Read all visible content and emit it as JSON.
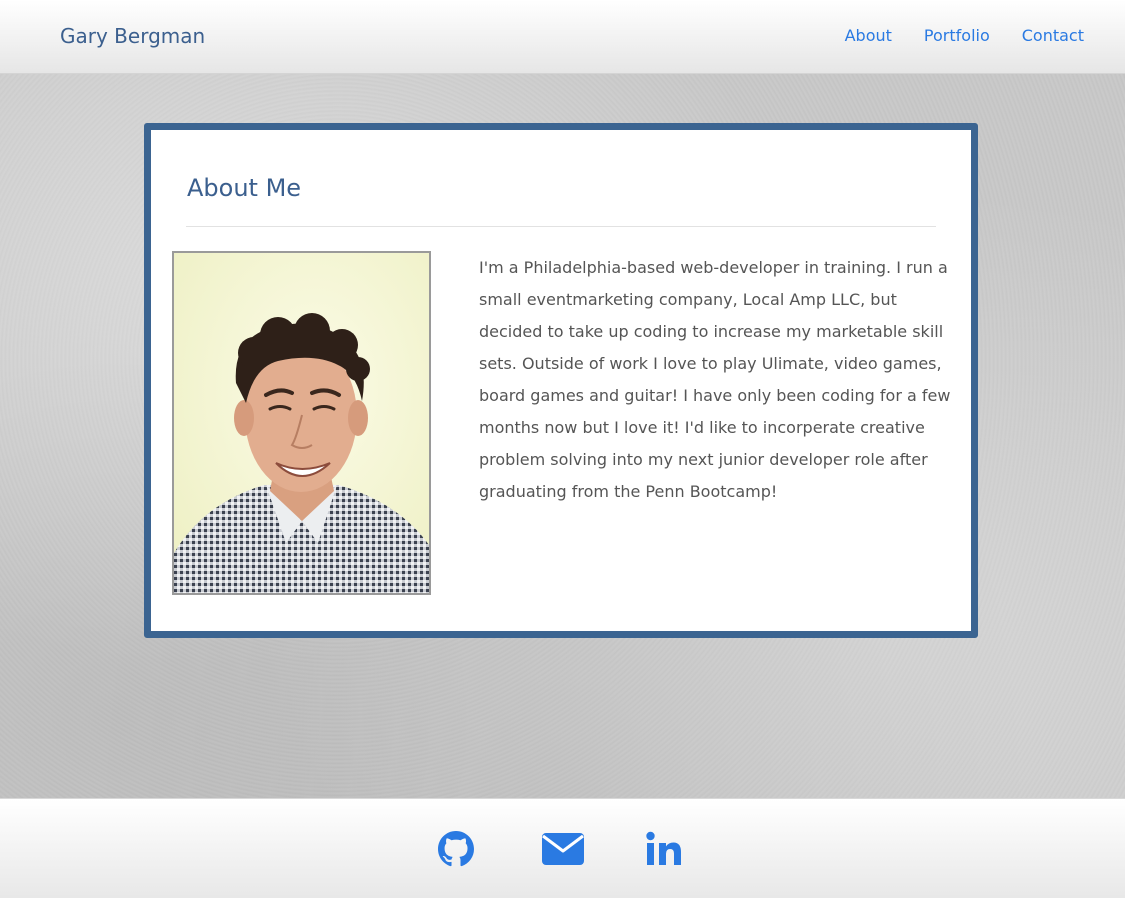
{
  "navbar": {
    "brand": "Gary Bergman",
    "links": [
      {
        "label": "About"
      },
      {
        "label": "Portfolio"
      },
      {
        "label": "Contact"
      }
    ]
  },
  "about": {
    "title": "About Me",
    "bio": "I'm a Philadelphia-based web-developer in training. I run a small eventmarketing company, Local Amp LLC, but decided to take up coding to increase my marketable skill sets. Outside of work I love to play Ulimate, video games, board games and guitar! I have only been coding for a few months now but I love it! I'd like to incorperate creative problem solving into my next junior developer role after graduating from the Penn Bootcamp!",
    "photo": {
      "subject": "portrait-photo"
    }
  },
  "footer": {
    "icons": [
      {
        "icon": "github-icon"
      },
      {
        "icon": "envelope-icon"
      },
      {
        "icon": "linkedin-icon"
      }
    ]
  },
  "colors": {
    "brand_text": "#3b5f8e",
    "link": "#2a7ae2",
    "card_border": "#3b6491",
    "body_text": "#555555"
  }
}
